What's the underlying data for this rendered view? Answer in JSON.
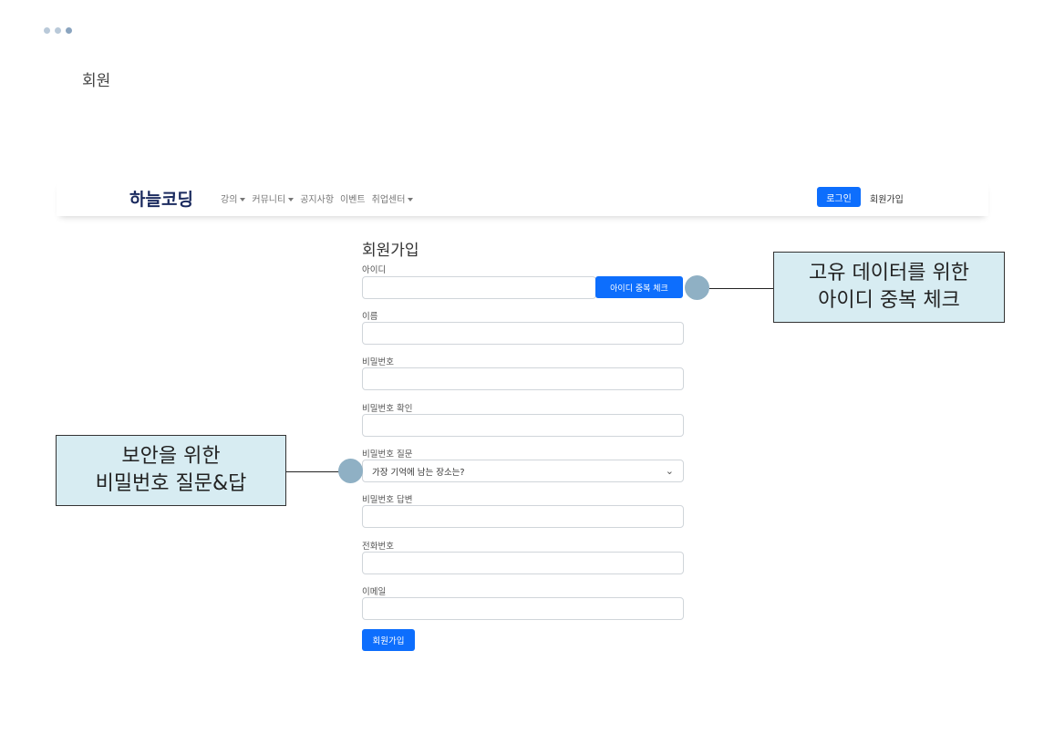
{
  "slide": {
    "page_label": "회원"
  },
  "navbar": {
    "brand": "하늘코딩",
    "links": [
      {
        "label": "강의",
        "dropdown": true
      },
      {
        "label": "커뮤니티",
        "dropdown": true
      },
      {
        "label": "공지사항",
        "dropdown": false
      },
      {
        "label": "이벤트",
        "dropdown": false
      },
      {
        "label": "취업센터",
        "dropdown": true
      }
    ],
    "login_label": "로그인",
    "signup_label": "회원가입"
  },
  "form": {
    "title": "회원가입",
    "id_label": "아이디",
    "id_check_button": "아이디 중복 체크",
    "name_label": "이름",
    "password_label": "비밀번호",
    "password_confirm_label": "비밀번호 확인",
    "question_label": "비밀번호 질문",
    "question_selected": "가장 기억에 남는 장소는?",
    "answer_label": "비밀번호 답변",
    "phone_label": "전화번호",
    "email_label": "이메일",
    "submit_label": "회원가입"
  },
  "annotations": {
    "id_check": {
      "line1": "고유 데이터를 위한",
      "line2": "아이디 중복 체크"
    },
    "security": {
      "line1": "보안을 위한",
      "line2": "비밀번호 질문&답"
    }
  },
  "colors": {
    "primary": "#0d6efd",
    "brand": "#1a2a5e",
    "callout_bg": "#d7ecf2",
    "pointer": "#8fb0c4"
  }
}
